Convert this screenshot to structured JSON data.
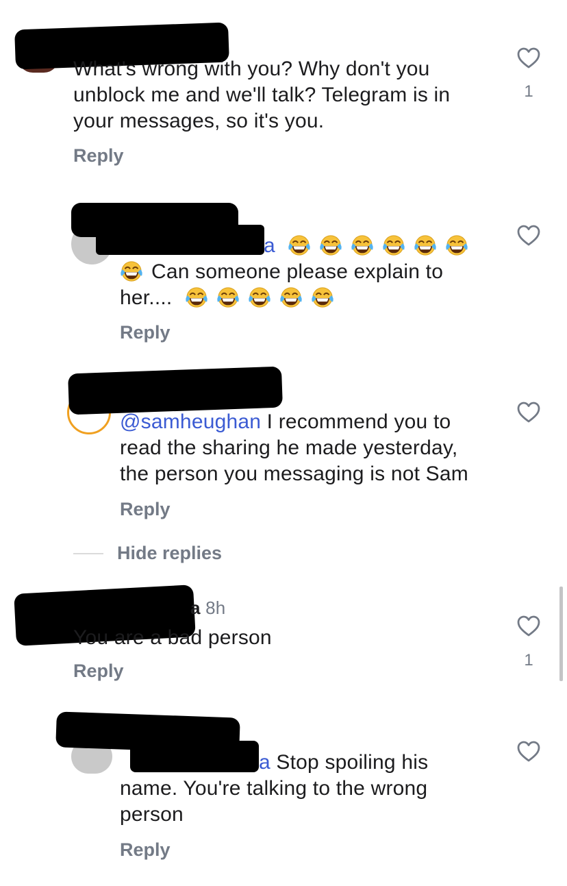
{
  "comments": [
    {
      "mention": "",
      "text": "What's wrong with you? Why don't you unblock me and we'll talk? Telegram is in your messages, so it's you.",
      "lines": [
        "What's wrong with you? Why don't you",
        "unblock me and we'll talk? Telegram is in",
        "your messages, so it's you."
      ],
      "reply": "Reply",
      "likes": "1"
    },
    {
      "mention_suffix": "a",
      "text_lines": [
        "Can someone please explain to",
        "her...."
      ],
      "reply": "Reply",
      "emoji_name": "face-with-tears-of-joy"
    },
    {
      "mention": "@samheughan",
      "lines": [
        " I recommend you to",
        "read the sharing he made yesterday,",
        "the person you messaging is not Sam"
      ],
      "reply": "Reply"
    },
    {
      "username_suffix": "a",
      "time": "8h",
      "text": "You are a bad person",
      "reply": "Reply",
      "likes": "1"
    },
    {
      "mention_suffix": "a",
      "lines": [
        " Stop spoiling his",
        "name. You're talking to the wrong",
        "person"
      ],
      "reply": "Reply"
    }
  ],
  "thread": {
    "hide_replies": "Hide replies"
  },
  "icons": {
    "like": "heart-outline-icon",
    "emoji": "face-with-tears-of-joy"
  },
  "colors": {
    "mention": "#3b5bd3",
    "secondary": "#737a86",
    "text": "#1c1c1e"
  }
}
